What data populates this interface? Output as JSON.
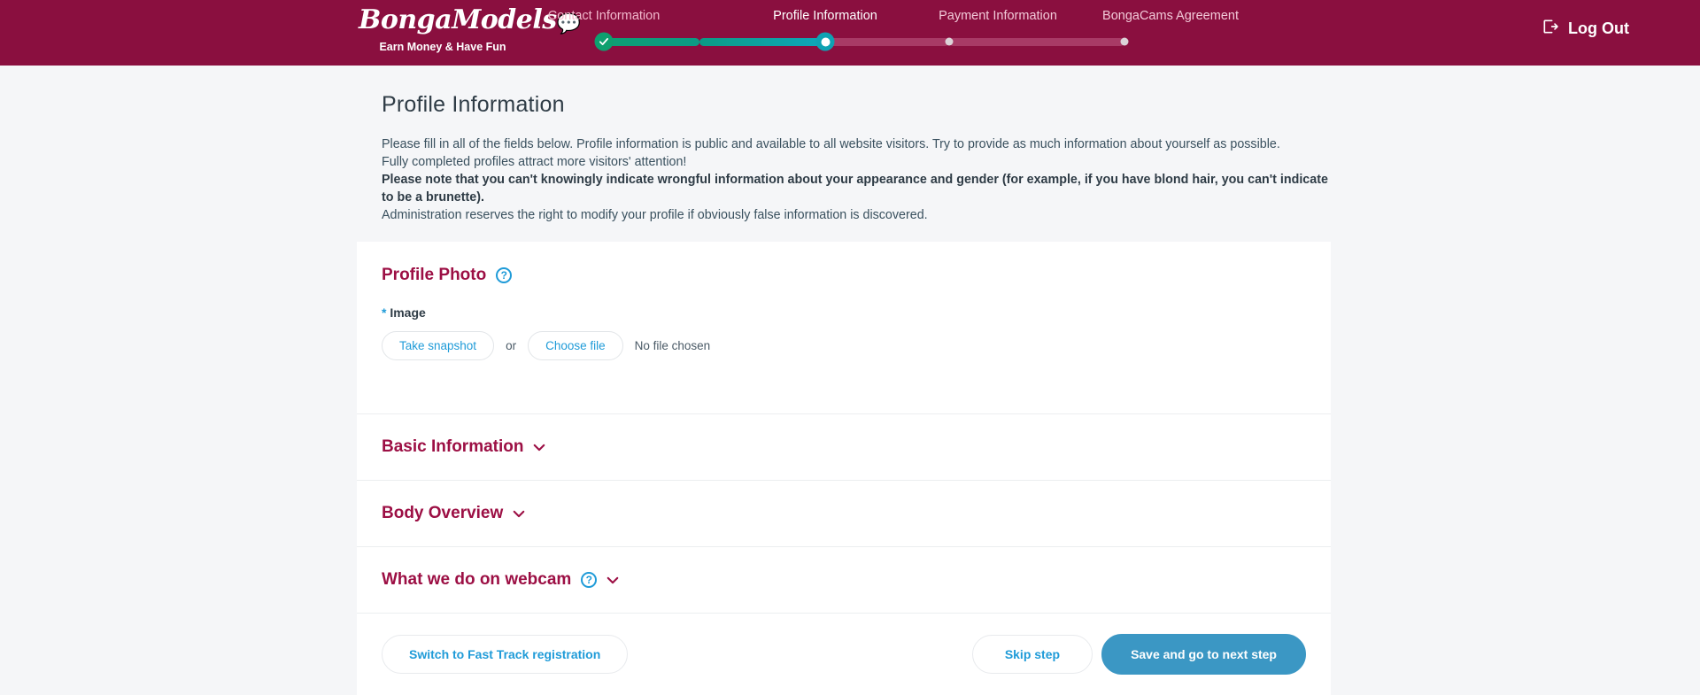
{
  "brand": {
    "name": "BongaModels",
    "bubble_icon": "speech-bubble-icon",
    "tagline": "Earn Money & Have Fun"
  },
  "header": {
    "logout_label": "Log Out",
    "logout_icon": "logout-icon",
    "colors": {
      "bar": "#8a0f3f",
      "progress_done": "#0ea06f",
      "progress_current": "#0ea2b3",
      "progress_empty": "#a83a66"
    }
  },
  "steps": [
    {
      "label": "Contact Information",
      "state": "done",
      "icon": "check-icon"
    },
    {
      "label": "Profile Information",
      "state": "current",
      "icon": "dot-icon"
    },
    {
      "label": "Payment Information",
      "state": "pending",
      "icon": "dot-icon"
    },
    {
      "label": "BongaCams Agreement",
      "state": "pending",
      "icon": "dot-icon"
    }
  ],
  "intro": {
    "title": "Profile Information",
    "line1": "Please fill in all of the fields below. Profile information is public and available to all website visitors. Try to provide as much information about yourself as possible.",
    "line2": "Fully completed profiles attract more visitors' attention!",
    "line3_bold": "Please note that you can't knowingly indicate wrongful information about your appearance and gender (for example, if you have blond hair, you can't indicate to be a brunette).",
    "line4": "Administration reserves the right to modify your profile if obviously false information is discovered."
  },
  "profile_photo": {
    "heading": "Profile Photo",
    "help_icon": "question-mark-icon",
    "field_required_mark": "*",
    "field_label": "Image",
    "take_snapshot_label": "Take snapshot",
    "or_label": "or",
    "choose_file_label": "Choose file",
    "file_status": "No file chosen"
  },
  "sections": [
    {
      "heading": "Basic Information",
      "has_help": false,
      "chevron": "chevron-down-icon"
    },
    {
      "heading": "Body Overview",
      "has_help": false,
      "chevron": "chevron-down-icon"
    },
    {
      "heading": "What we do on webcam",
      "has_help": true,
      "help_icon": "question-mark-icon",
      "chevron": "chevron-down-icon"
    }
  ],
  "actions": {
    "fast_track_label": "Switch to Fast Track registration",
    "skip_label": "Skip step",
    "save_label": "Save and go to next step"
  }
}
